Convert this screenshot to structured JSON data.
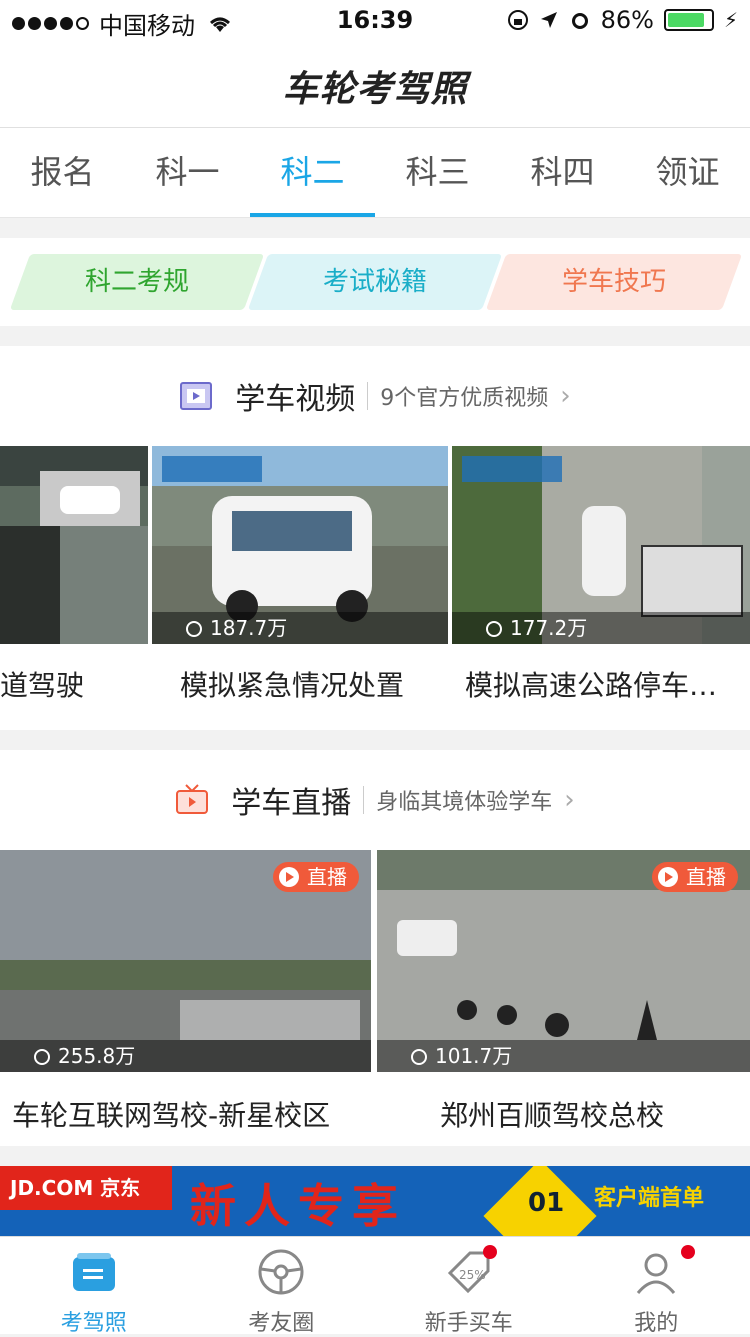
{
  "status": {
    "carrier": "中国移动",
    "time": "16:39",
    "battery": "86%",
    "battery_level": 0.86
  },
  "header": {
    "logo": "车轮考驾照"
  },
  "tabs": [
    "报名",
    "科一",
    "科二",
    "科三",
    "科四",
    "领证"
  ],
  "active_tab": "科二",
  "quick_links": [
    "科二考规",
    "考试秘籍",
    "学车技巧"
  ],
  "video_section": {
    "title": "学车视频",
    "subtitle": "9个官方优质视频",
    "items": [
      {
        "title": "道驾驶",
        "views": ""
      },
      {
        "title": "模拟紧急情况处置",
        "views": "187.7万"
      },
      {
        "title": "模拟高速公路停车…",
        "views": "177.2万"
      }
    ]
  },
  "live_section": {
    "title": "学车直播",
    "subtitle": "身临其境体验学车",
    "badge": "直播",
    "items": [
      {
        "title": "车轮互联网驾校-新星校区",
        "views": "255.8万"
      },
      {
        "title": "郑州百顺驾校总校",
        "views": "101.7万"
      }
    ]
  },
  "banner": {
    "brand": "JD.COM 京东",
    "headline": "新人专享",
    "event_num": "01",
    "promo": "客户端首单"
  },
  "bottom_tabs": [
    "考驾照",
    "考友圈",
    "新手买车",
    "我的"
  ],
  "colors": {
    "accent": "#1aa6e6",
    "live": "#f05a3a",
    "jd_red": "#e1251b"
  }
}
